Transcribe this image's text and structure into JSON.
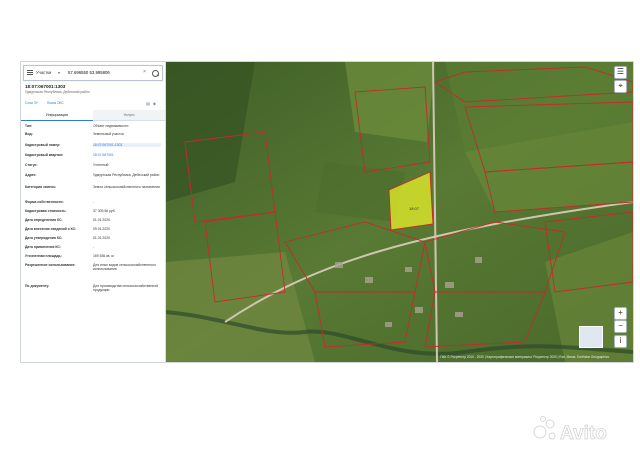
{
  "search": {
    "type_label": "Участки",
    "query": "57.696550 53.995806"
  },
  "object": {
    "cadastral_number": "18:07:067001:1303",
    "address_short": "Удмуртская Республика, Дебесский район"
  },
  "panel_links": {
    "layer": "Слои ЗУ",
    "oks": "Поиск ОКС"
  },
  "tabs": {
    "info": "Информация",
    "services": "Услуги"
  },
  "info_rows": [
    {
      "label": "Тип:",
      "value": "Объект недвижимости"
    },
    {
      "label": "Вид:",
      "value": "Земельный участок"
    },
    {
      "label": "Кадастровый номер:",
      "value": "18:07:067001:1303"
    },
    {
      "label": "Кадастровый квартал:",
      "value": "18:07:067001"
    },
    {
      "label": "Статус:",
      "value": "Учтенный"
    },
    {
      "label": "Адрес:",
      "value": "Удмуртская Республика, Дебесский район"
    },
    {
      "label": "Категория земель:",
      "value": "Земли сельскохозяйственного назначения"
    },
    {
      "label": "Форма собственности:",
      "value": "-"
    },
    {
      "label": "Кадастровая стоимость:",
      "value": "37 309,56 руб."
    },
    {
      "label": "Дата определения КС:",
      "value": "01.01.2020"
    },
    {
      "label": "Дата внесения сведений о КС:",
      "value": "09.01.2020"
    },
    {
      "label": "Дата утверждения КС:",
      "value": "01.01.2020"
    },
    {
      "label": "Дата применения КС:",
      "value": "-"
    },
    {
      "label": "Уточненная площадь:",
      "value": "169 536 кв. м"
    },
    {
      "label": "Разрешенное использование:",
      "value": "Для иных видов сельскохозяйственного использования"
    },
    {
      "label": "По документу:",
      "value": "Для производства сельскохозяйственной продукции"
    }
  ],
  "map": {
    "parcel_label": "18:07",
    "attribution": "ПКК © Росреестр 2010 - 2020 | Картографические материалы: Росреестр 2020 | Esri, Maxar, Earthstar Geographics",
    "zoom_in": "+",
    "zoom_out": "−",
    "colors": {
      "parcel_outline": "#c42b2b",
      "selected_fill": "#e8f22a",
      "imagery": "#4a6a2e"
    }
  },
  "watermark": {
    "brand": "Avito"
  }
}
